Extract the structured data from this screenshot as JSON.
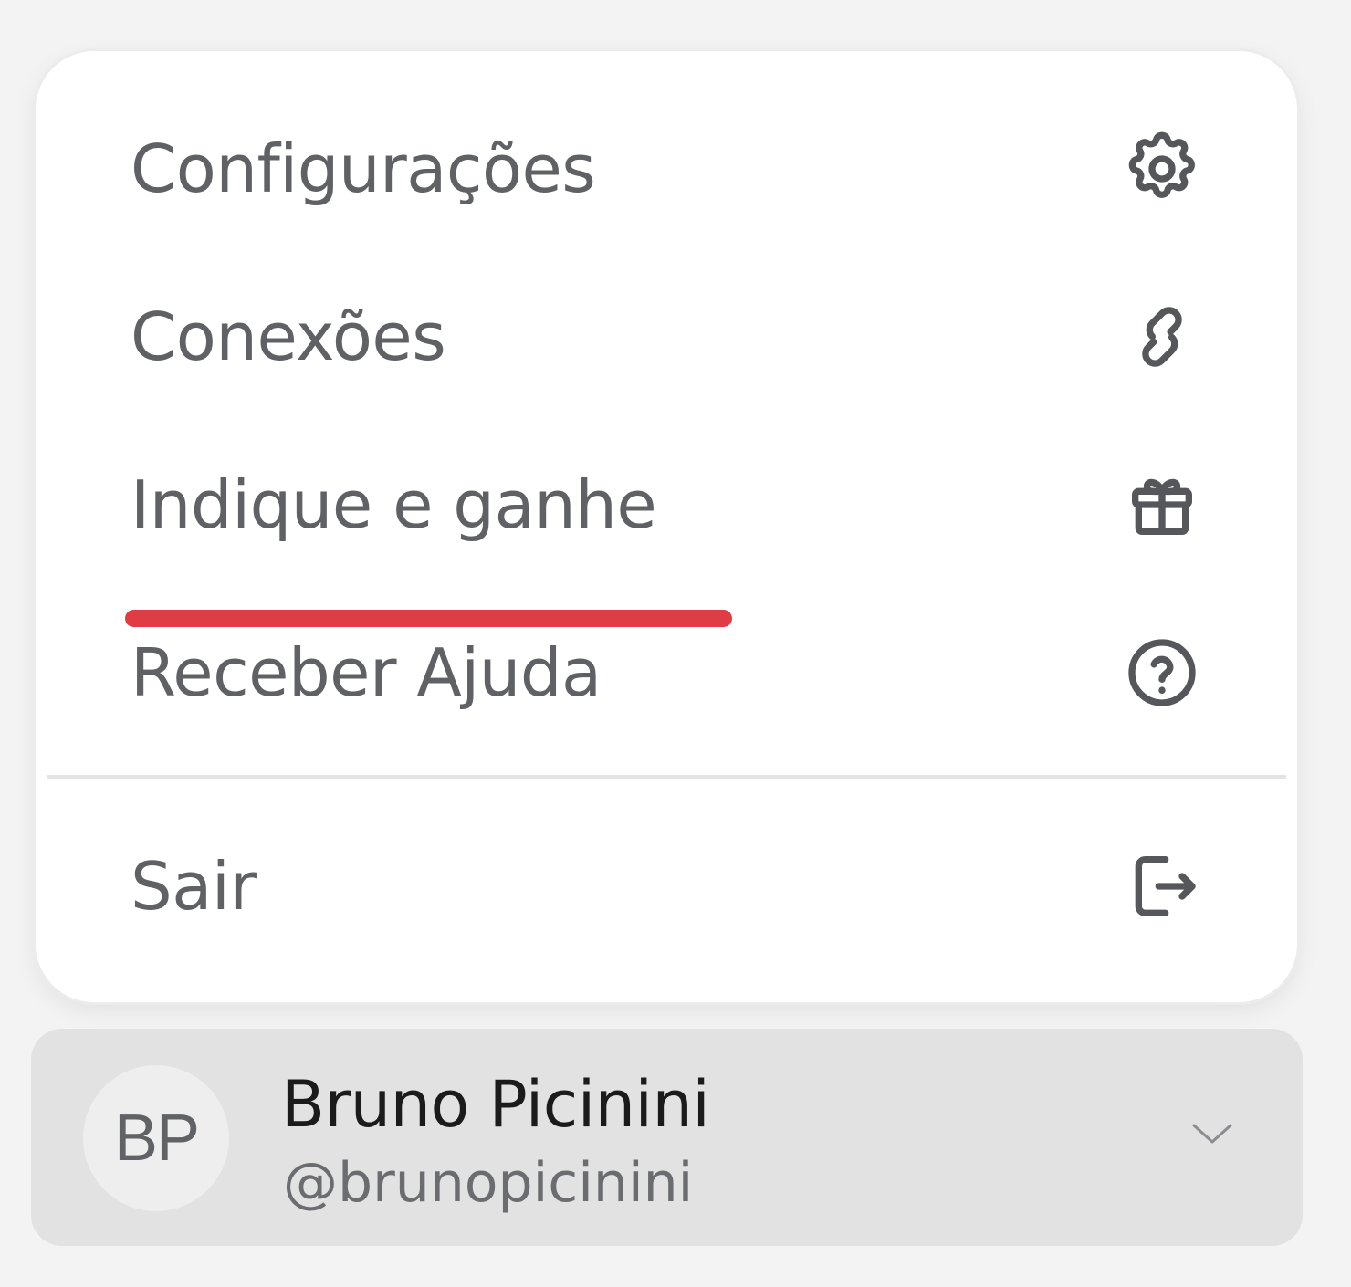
{
  "menu": {
    "items": [
      {
        "label": "Configurações",
        "icon": "gear-icon"
      },
      {
        "label": "Conexões",
        "icon": "link-icon"
      },
      {
        "label": "Indique e ganhe",
        "icon": "gift-icon"
      },
      {
        "label": "Receber Ajuda",
        "icon": "help-circle-icon"
      }
    ],
    "logout": {
      "label": "Sair",
      "icon": "logout-icon"
    }
  },
  "annotation": {
    "color": "#e03c45"
  },
  "user": {
    "initials": "BP",
    "name": "Bruno Picinini",
    "handle": "@brunopicinini",
    "chevron_icon": "chevron-down-icon"
  }
}
